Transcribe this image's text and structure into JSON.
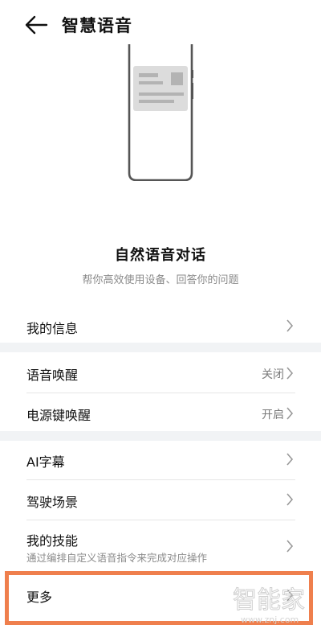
{
  "header": {
    "title": "智慧语音",
    "back_icon": "arrow-left-icon"
  },
  "intro": {
    "title": "自然语音对话",
    "subtitle": "帮你高效使用设备、回答你的问题"
  },
  "groups": [
    {
      "items": [
        {
          "label": "我的信息",
          "value": ""
        }
      ]
    },
    {
      "items": [
        {
          "label": "语音唤醒",
          "value": "关闭"
        },
        {
          "label": "电源键唤醒",
          "value": "开启"
        }
      ]
    },
    {
      "items": [
        {
          "label": "AI字幕",
          "value": ""
        },
        {
          "label": "驾驶场景",
          "value": ""
        },
        {
          "label": "我的技能",
          "value": "",
          "subtitle": "通过编排自定义语音指令来完成对应操作"
        },
        {
          "label": "更多",
          "value": ""
        }
      ]
    }
  ],
  "watermark": {
    "text": "智能家",
    "url": "www.znj.com"
  },
  "colors": {
    "highlight": "#ef7f4d",
    "separator": "#f1f3f5",
    "secondary_text": "#8a8a8a"
  }
}
